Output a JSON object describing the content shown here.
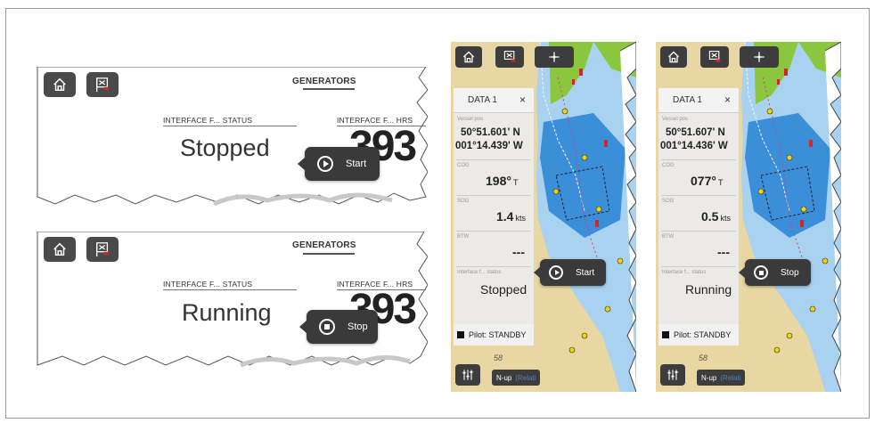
{
  "colors": {
    "button_bg": "#4a4a4a",
    "pill_bg": "#3a3a3a",
    "sea_deep": "#3b8fd9",
    "sea_shallow": "#a8d2f0",
    "land": "#e8d6a3",
    "green": "#8cc63f",
    "red_marker": "#d4252a"
  },
  "icons": {
    "home": "home-icon",
    "mob": "mob-flag-icon",
    "waypoint": "waypoint-icon",
    "menu": "sliders-icon",
    "play": "play-icon",
    "stop": "stop-icon"
  },
  "generator_top": {
    "title": "GENERATORS",
    "status_label": "INTERFACE F... STATUS",
    "hrs_label": "INTERFACE F... HRS",
    "state": "Stopped",
    "hours": "393",
    "action": "Start"
  },
  "generator_bottom": {
    "title": "GENERATORS",
    "status_label": "INTERFACE F... STATUS",
    "hrs_label": "INTERFACE F... HRS",
    "state": "Running",
    "hours": "393",
    "action": "Stop"
  },
  "chart_left": {
    "panel_title": "DATA 1",
    "close": "×",
    "vessel_label": "Vessel pos",
    "lat": "50°51.601' N",
    "lon": "001°14.439' W",
    "cog_label": "COG",
    "cog": "198°",
    "cog_unit": "T",
    "sog_label": "SOG",
    "sog": "1.4",
    "sog_unit": "kts",
    "btw_label": "BTW",
    "btw": "---",
    "status_label": "Interface f... status",
    "state": "Stopped",
    "action": "Start",
    "pilot": "Pilot: STANDBY",
    "orientation": "N-up",
    "mode": "(Relati",
    "depth": "58"
  },
  "chart_right": {
    "panel_title": "DATA 1",
    "close": "×",
    "vessel_label": "Vessel pos",
    "lat": "50°51.607' N",
    "lon": "001°14.436' W",
    "cog_label": "COG",
    "cog": "077°",
    "cog_unit": "T",
    "sog_label": "SOG",
    "sog": "0.5",
    "sog_unit": "kts",
    "btw_label": "BTW",
    "btw": "---",
    "status_label": "Interface f... status",
    "state": "Running",
    "action": "Stop",
    "pilot": "Pilot: STANDBY",
    "orientation": "N-up",
    "mode": "(Relati",
    "depth": "58"
  }
}
